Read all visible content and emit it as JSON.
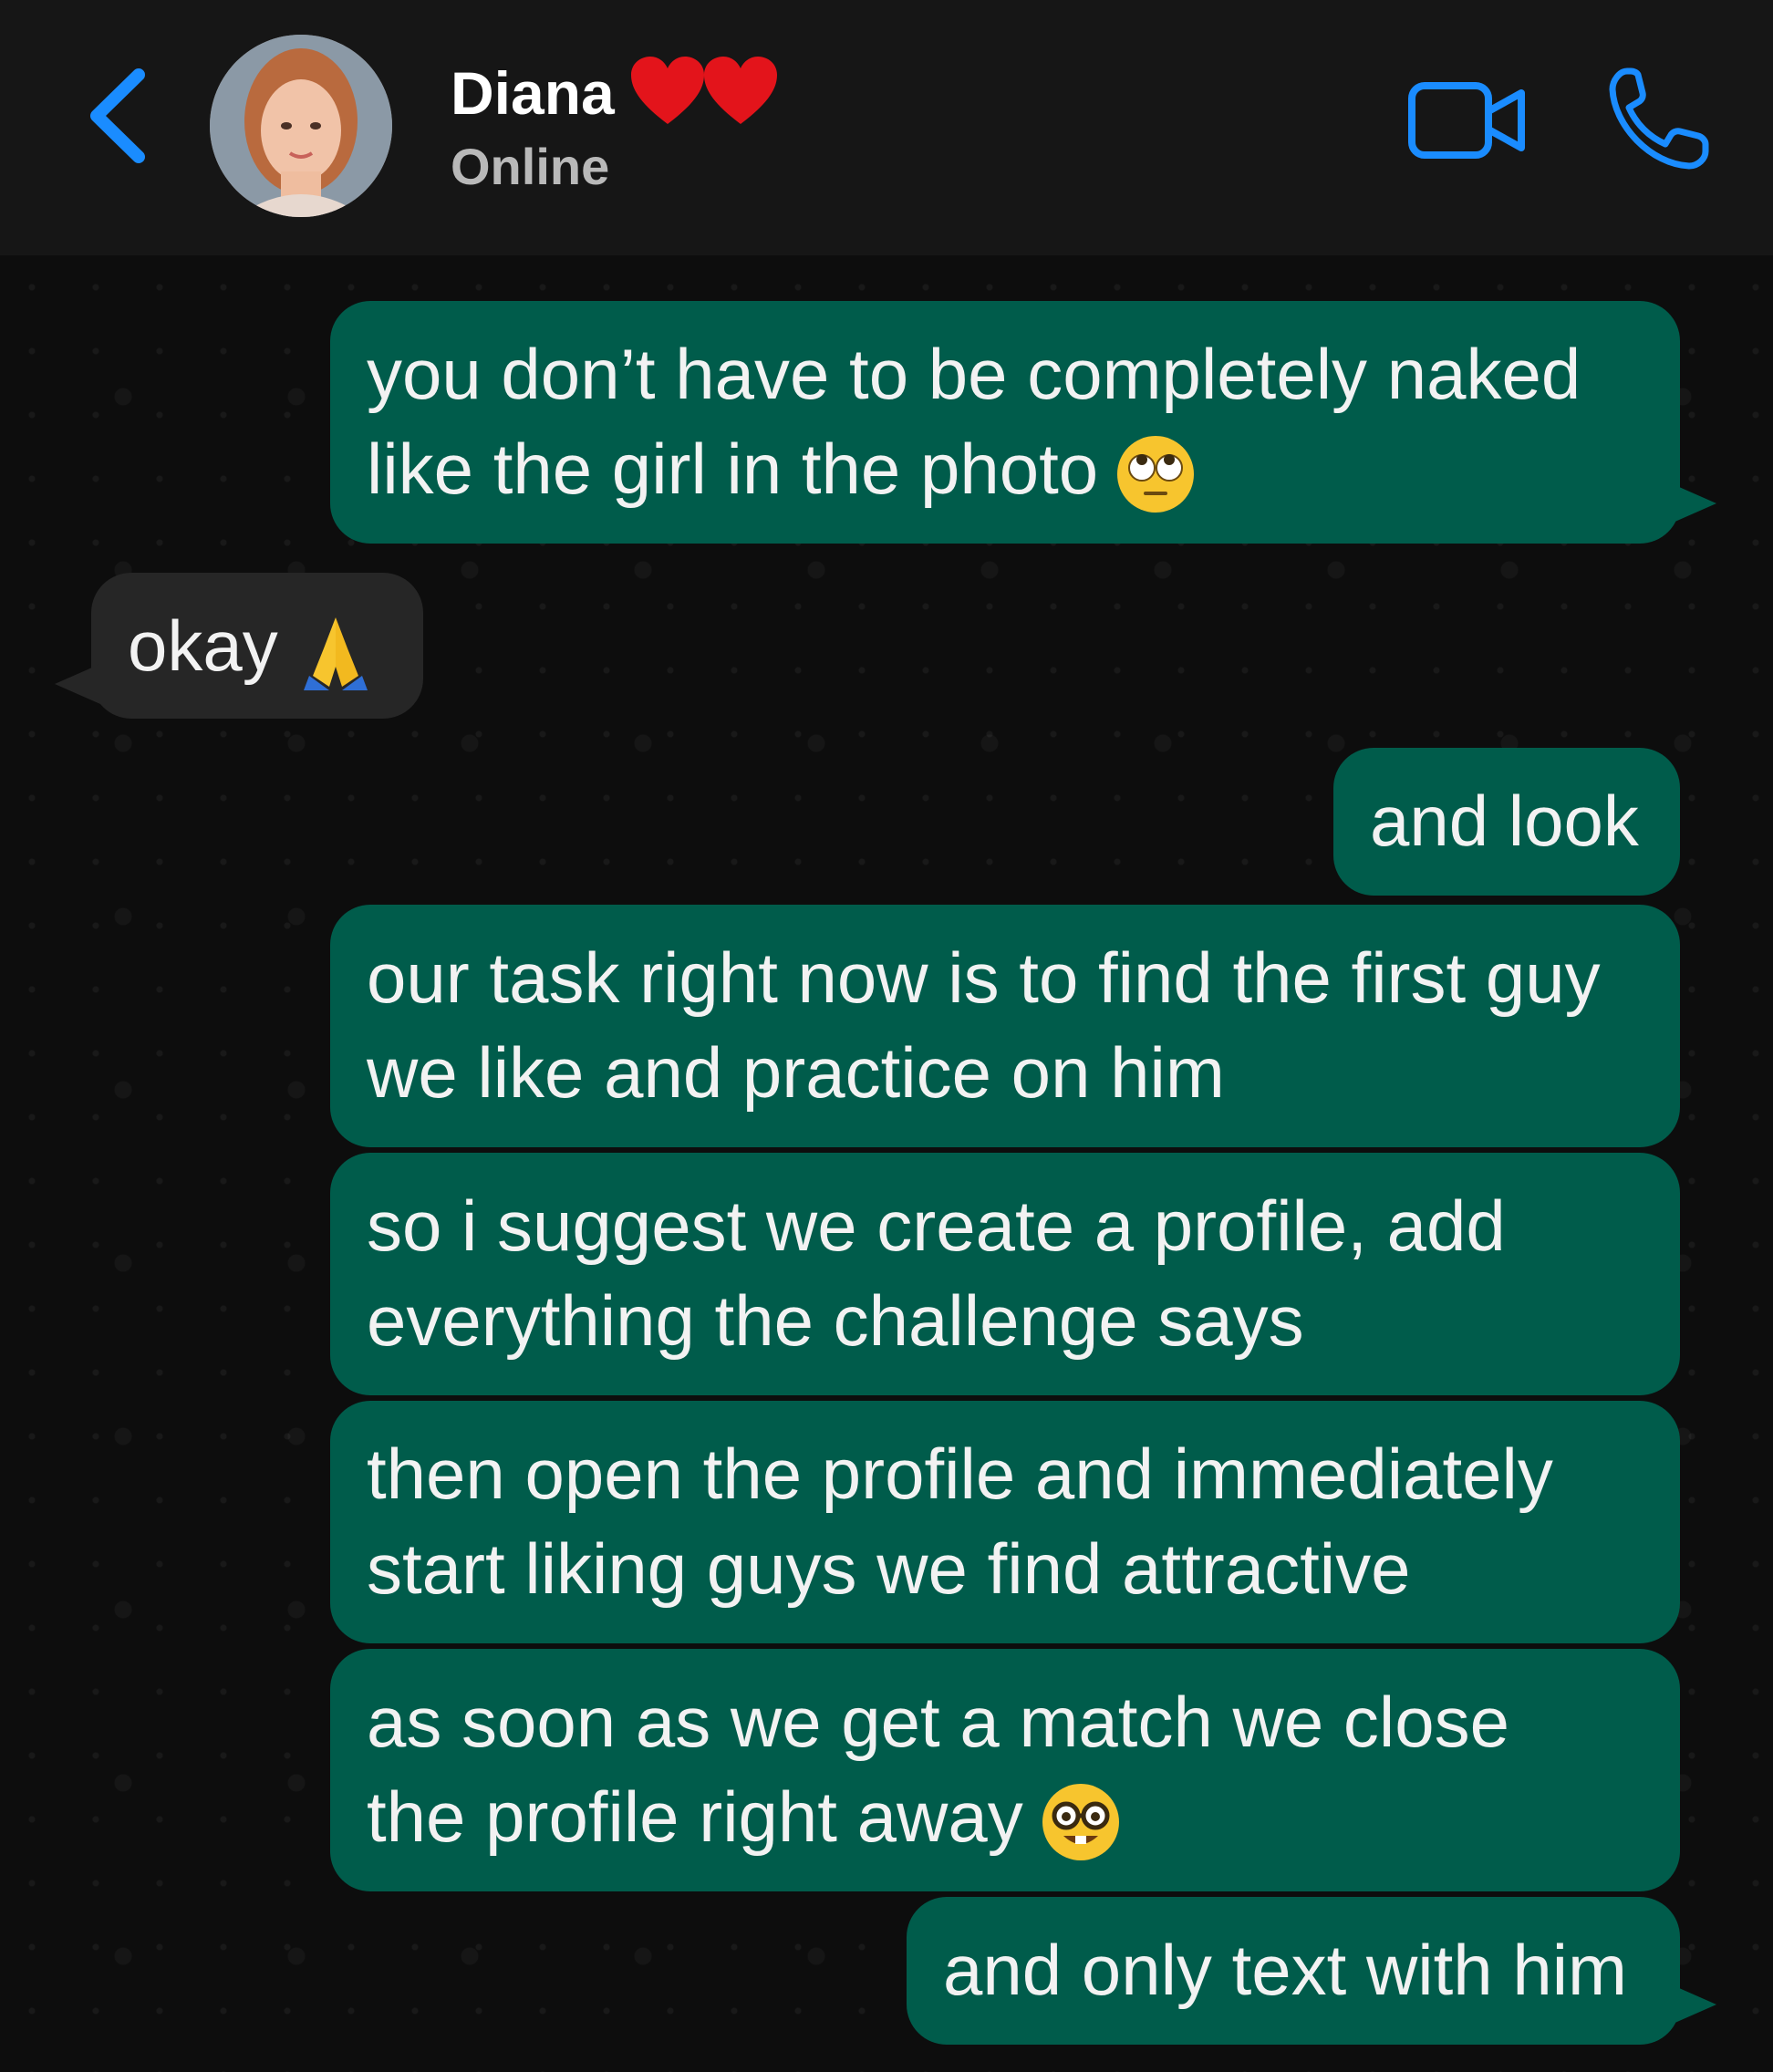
{
  "header": {
    "contact_name": "Diana",
    "status": "Online",
    "name_emoji": "❤️❤️"
  },
  "icons": {
    "back": "chevron-left-icon",
    "video": "video-camera-icon",
    "call": "phone-icon"
  },
  "colors": {
    "accent": "#1a8cff",
    "outgoing_bubble": "#005c4b",
    "incoming_bubble": "#262626",
    "header_bg": "#161616",
    "chat_bg": "#0d0d0d"
  },
  "messages": [
    {
      "direction": "outgoing",
      "lines": [
        "you don’t have to be completely naked",
        "like the girl in the photo"
      ],
      "emoji": "face-with-rolling-eyes"
    },
    {
      "direction": "incoming",
      "lines": [
        "okay"
      ],
      "emoji": "folded-hands"
    },
    {
      "direction": "outgoing",
      "lines": [
        "and look"
      ]
    },
    {
      "direction": "outgoing",
      "lines": [
        "our task right now is to find the first guy",
        "we like and practice on him"
      ]
    },
    {
      "direction": "outgoing",
      "lines": [
        "so i suggest we create a profile, add",
        "everything the challenge says"
      ]
    },
    {
      "direction": "outgoing",
      "lines": [
        "then open the profile and immediately",
        "start liking guys we find attractive"
      ]
    },
    {
      "direction": "outgoing",
      "lines": [
        "as soon as we get a match we close",
        "the profile right away"
      ],
      "emoji": "nerd-face"
    },
    {
      "direction": "outgoing",
      "lines": [
        "and only text with him"
      ]
    }
  ]
}
